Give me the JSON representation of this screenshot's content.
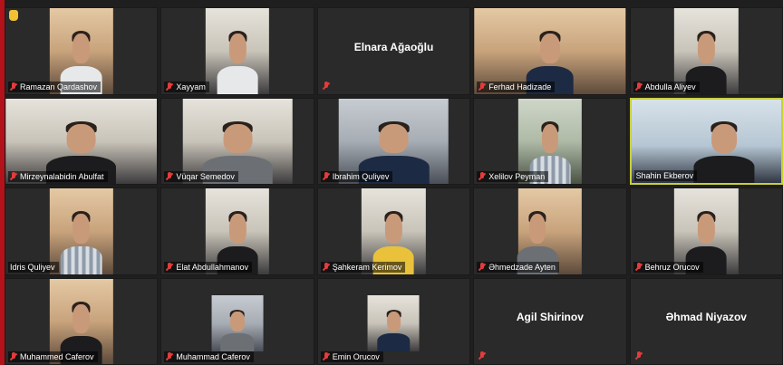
{
  "participants": [
    {
      "name": "Ramazan Qardashov",
      "video": true,
      "raised_hand": true
    },
    {
      "name": "Xayyam",
      "video": true
    },
    {
      "name": "Elnara Ağaoğlu",
      "video": false
    },
    {
      "name": "Ferhad Hadizade",
      "video": true
    },
    {
      "name": "Abdulla Aliyev",
      "video": true
    },
    {
      "name": "Mirzeynalabidin Abulfat",
      "video": true
    },
    {
      "name": "Vüqar Semedov",
      "video": true
    },
    {
      "name": "Ibrahim Quliyev",
      "video": true
    },
    {
      "name": "Xelilov Peyman",
      "video": true
    },
    {
      "name": "Shahin Ekberov",
      "video": true,
      "active_speaker": true
    },
    {
      "name": "Idris Quliyev",
      "video": true
    },
    {
      "name": "Elat Abdullahmanov",
      "video": true
    },
    {
      "name": "Şahkeram Kerimov",
      "video": true
    },
    {
      "name": "Əhmedzade Ayten",
      "video": true
    },
    {
      "name": "Behruz Orucov",
      "video": true
    },
    {
      "name": "Muhammed Caferov",
      "video": true
    },
    {
      "name": "Muhammad Caferov",
      "video": true
    },
    {
      "name": "Emin Orucov",
      "video": true
    },
    {
      "name": "Agil Shirinov",
      "video": false
    },
    {
      "name": "Əhmad Niyazov",
      "video": false
    }
  ],
  "colors": {
    "tile_bg": "#2a2a2a",
    "muted_mic": "#e43b3b",
    "active_speaker_border": "#c9cf3a",
    "raised_hand": "#f2c233"
  }
}
